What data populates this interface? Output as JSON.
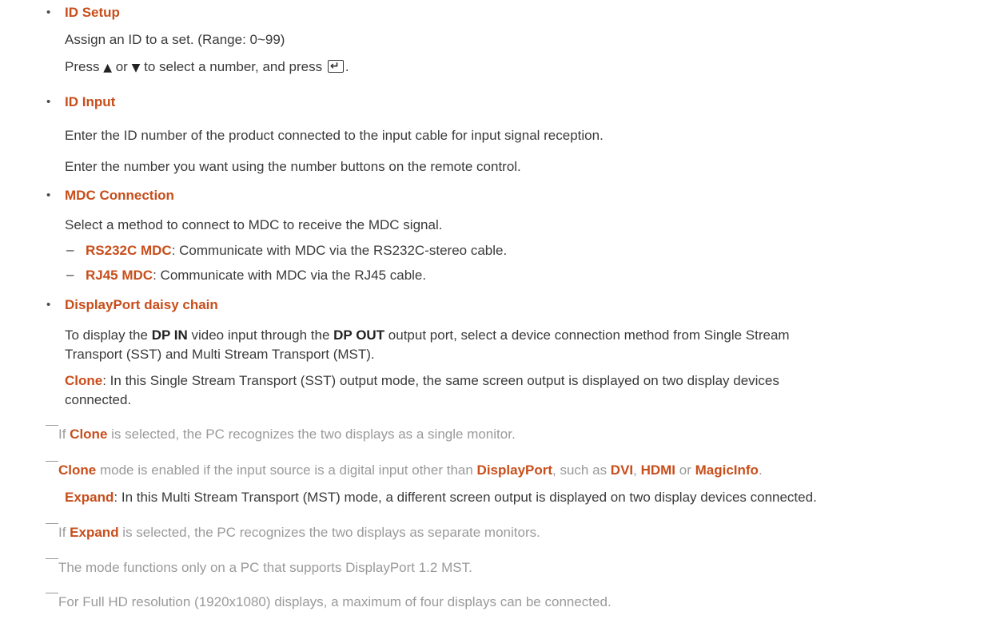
{
  "sections": {
    "id_setup": {
      "title": "ID Setup",
      "line1": "Assign an ID to a set. (Range: 0~99)",
      "line2_press": "Press",
      "line2_or": "or",
      "line2_rest": "to select a number, and press",
      "line2_end": "."
    },
    "id_input": {
      "title": "ID Input",
      "line1": "Enter the ID number of the product connected to the input cable for input signal reception.",
      "line2": "Enter the number you want using the number buttons on the remote control."
    },
    "mdc_connection": {
      "title": "MDC Connection",
      "line1": "Select a method to connect to MDC to receive the MDC signal.",
      "items": [
        {
          "name": "RS232C MDC",
          "desc": ": Communicate with MDC via the RS232C-stereo cable."
        },
        {
          "name": "RJ45 MDC",
          "desc": ": Communicate with MDC via the RJ45 cable."
        }
      ]
    },
    "daisy_chain": {
      "title": "DisplayPort daisy chain",
      "p1_a": "To display the ",
      "p1_dpin": "DP IN",
      "p1_b": " video input through the ",
      "p1_dpout": "DP OUT",
      "p1_c": " output port, select a device connection method from Single Stream",
      "p1_line2": "Transport (SST) and Multi Stream Transport (MST).",
      "clone_label": "Clone",
      "clone_desc": ": In this Single Stream Transport (SST) output mode, the same screen output is displayed on two display devices",
      "clone_desc2": "connected.",
      "note1_a": "If ",
      "note1_clone": "Clone",
      "note1_b": " is selected, the PC recognizes the two displays as a single monitor.",
      "note2_clone": "Clone",
      "note2_a": " mode is enabled if the input source is a digital input other than ",
      "note2_dp": "DisplayPort",
      "note2_b": ", such as ",
      "note2_dvi": "DVI",
      "note2_c": ", ",
      "note2_hdmi": "HDMI",
      "note2_d": " or ",
      "note2_mi": "MagicInfo",
      "note2_e": ".",
      "expand_label": "Expand",
      "expand_desc": ": In this Multi Stream Transport (MST) mode, a different screen output is displayed on two display devices connected.",
      "note3_a": "If ",
      "note3_expand": "Expand",
      "note3_b": " is selected, the PC recognizes the two displays as separate monitors.",
      "note4": "The mode functions only on a PC that supports DisplayPort 1.2 MST.",
      "note5": "For Full HD resolution (1920x1080) displays, a maximum of four displays can be connected."
    }
  }
}
